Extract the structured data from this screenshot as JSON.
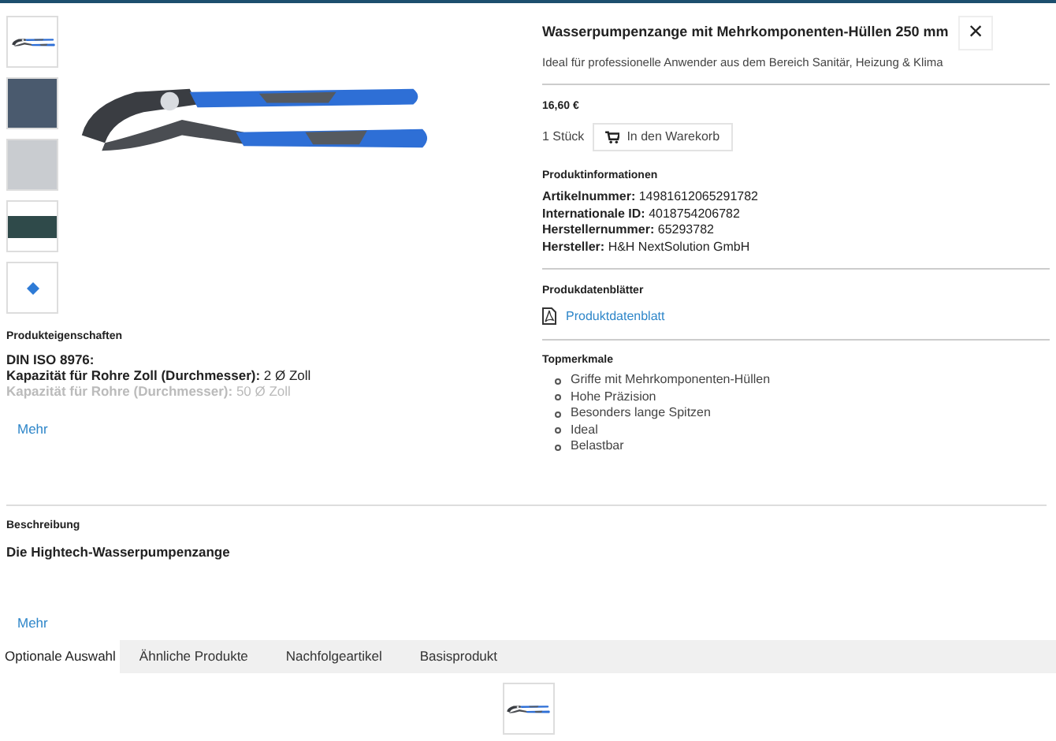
{
  "product": {
    "title": "Wasserpumpenzange mit Mehrkomponenten-Hüllen 250 mm",
    "close": "×",
    "subtitle": "Ideal für professionelle Anwender aus dem Bereich Sanitär, Heizung & Klima",
    "price": "16,60 €",
    "quantity": "1 Stück",
    "cart_button": "In den Warekorb"
  },
  "product_info": {
    "heading": "Produktinformationen",
    "fields": [
      {
        "label": "Artikelnummer:",
        "value": "14981612065291782"
      },
      {
        "label": "Internationale ID:",
        "value": "4018754206782"
      },
      {
        "label": "Herstellernummer:",
        "value": "65293782"
      },
      {
        "label": "Hersteller:",
        "value": "H&H NextSolution GmbH"
      }
    ]
  },
  "datasheets": {
    "heading": "Produkdatenblätter",
    "link": "Produktdatenblatt"
  },
  "top_features": {
    "heading": "Topmerkmale",
    "items": [
      "Griffe mit Mehrkomponenten-Hüllen",
      "Hohe Präzision",
      "Besonders lange Spitzen",
      "Ideal",
      "Belastbar"
    ]
  },
  "properties": {
    "heading": "Produkteigenschaften",
    "lines": [
      {
        "label": "DIN ISO 8976:",
        "faded": false
      },
      {
        "label": "Kapazität für Rohre Zoll (Durchmesser):",
        "value": "2 Ø Zoll",
        "faded": false
      },
      {
        "label": "Kapazität für Rohre (Durchmesser):",
        "value": "50 Ø Zoll",
        "faded": true
      }
    ],
    "more": "Mehr"
  },
  "description": {
    "heading": "Beschreibung",
    "text": "Die Hightech-Wasserpumpenzange",
    "more": "Mehr"
  },
  "tabs": [
    {
      "label": "Optionale Auswahl",
      "selected": true
    },
    {
      "label": "Ähnliche Produkte",
      "selected": false
    },
    {
      "label": "Nachfolgeartikel",
      "selected": false
    },
    {
      "label": "Basisprodukt",
      "selected": false
    }
  ]
}
